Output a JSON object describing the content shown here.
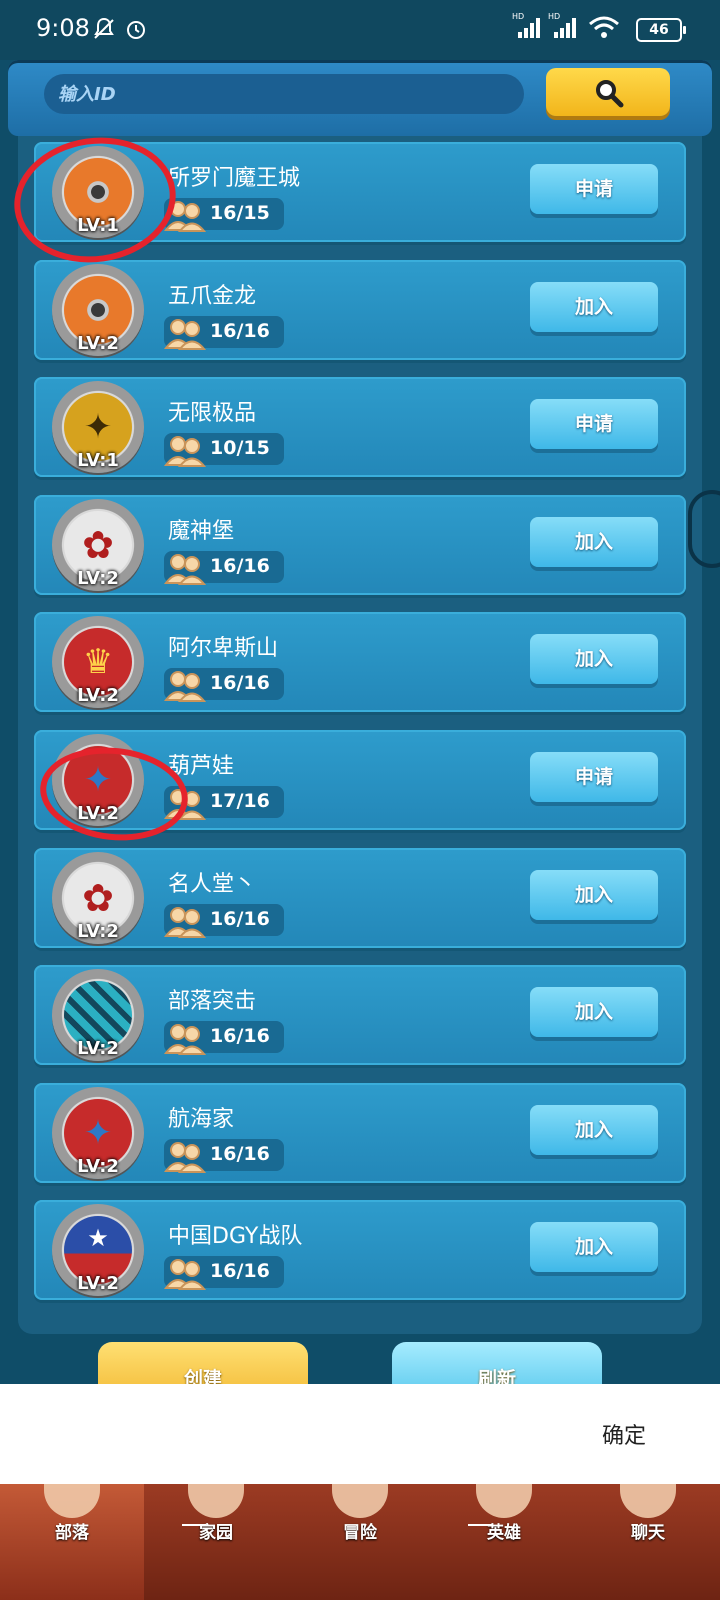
{
  "status_bar": {
    "time": "9:08",
    "battery": "46",
    "signal1_label": "HD",
    "signal2_label": "HD"
  },
  "search": {
    "placeholder": "输入ID"
  },
  "tribes": [
    {
      "name": "所罗门魔王城",
      "level": "LV:1",
      "members": "16/15",
      "action": "申请",
      "emblem": "orange-shuriken"
    },
    {
      "name": "五爪金龙",
      "level": "LV:2",
      "members": "16/16",
      "action": "加入",
      "emblem": "orange-shuriken"
    },
    {
      "name": "无限极品",
      "level": "LV:1",
      "members": "10/15",
      "action": "申请",
      "emblem": "gold-eagle"
    },
    {
      "name": "魔神堡",
      "level": "LV:2",
      "members": "16/16",
      "action": "加入",
      "emblem": "maple-leaf"
    },
    {
      "name": "阿尔卑斯山",
      "level": "LV:2",
      "members": "16/16",
      "action": "加入",
      "emblem": "crown"
    },
    {
      "name": "葫芦娃",
      "level": "LV:2",
      "members": "17/16",
      "action": "申请",
      "emblem": "blue-eagle"
    },
    {
      "name": "名人堂丶",
      "level": "LV:2",
      "members": "16/16",
      "action": "加入",
      "emblem": "maple-leaf"
    },
    {
      "name": "部落突击",
      "level": "LV:2",
      "members": "16/16",
      "action": "加入",
      "emblem": "teal-shield"
    },
    {
      "name": "航海家",
      "level": "LV:2",
      "members": "16/16",
      "action": "加入",
      "emblem": "blue-eagle"
    },
    {
      "name": "中国DGY战队",
      "level": "LV:2",
      "members": "16/16",
      "action": "加入",
      "emblem": "star-tent"
    }
  ],
  "bottom_buttons": {
    "create": "创建",
    "refresh": "刷新"
  },
  "sheet": {
    "confirm": "确定"
  },
  "nav": {
    "items": [
      "部落",
      "家园",
      "冒险",
      "英雄",
      "聊天"
    ],
    "active": 0
  },
  "colors": {
    "accent_yellow": "#f2b51b",
    "panel_blue": "#2387b8",
    "annotation_red": "#e5232c",
    "nav_brown": "#8c2f1a"
  }
}
